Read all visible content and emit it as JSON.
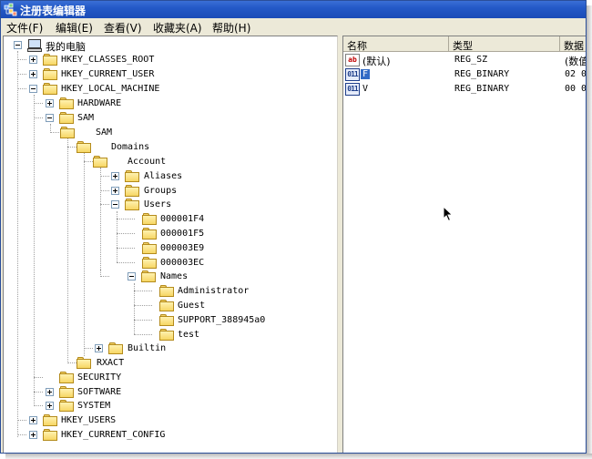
{
  "window": {
    "title": "注册表编辑器",
    "menu": [
      "文件(F)",
      "编辑(E)",
      "查看(V)",
      "收藏夹(A)",
      "帮助(H)"
    ]
  },
  "tree": {
    "root": "我的电脑",
    "nodes": [
      {
        "label": "HKEY_CLASSES_ROOT",
        "expander": "plus"
      },
      {
        "label": "HKEY_CURRENT_USER",
        "expander": "plus"
      },
      {
        "label": "HKEY_LOCAL_MACHINE",
        "expander": "minus"
      },
      {
        "label": "HARDWARE",
        "expander": "plus"
      },
      {
        "label": "SAM",
        "expander": "minus"
      },
      {
        "label": "SAM",
        "expander": "minus"
      },
      {
        "label": "Domains",
        "expander": "minus"
      },
      {
        "label": "Account",
        "expander": "minus"
      },
      {
        "label": "Aliases",
        "expander": "plus"
      },
      {
        "label": "Groups",
        "expander": "plus"
      },
      {
        "label": "Users",
        "expander": "minus"
      },
      {
        "label": "000001F4",
        "expander": "none"
      },
      {
        "label": "000001F5",
        "expander": "none"
      },
      {
        "label": "000003E9",
        "expander": "none"
      },
      {
        "label": "000003EC",
        "expander": "none"
      },
      {
        "label": "Names",
        "expander": "minus"
      },
      {
        "label": "Administrator",
        "expander": "none"
      },
      {
        "label": "Guest",
        "expander": "none"
      },
      {
        "label": "SUPPORT_388945a0",
        "expander": "none"
      },
      {
        "label": "test",
        "expander": "none"
      },
      {
        "label": "Builtin",
        "expander": "plus"
      },
      {
        "label": "RXACT",
        "expander": "none"
      },
      {
        "label": "SECURITY",
        "expander": "none"
      },
      {
        "label": "SOFTWARE",
        "expander": "plus"
      },
      {
        "label": "SYSTEM",
        "expander": "plus"
      },
      {
        "label": "HKEY_USERS",
        "expander": "plus"
      },
      {
        "label": "HKEY_CURRENT_CONFIG",
        "expander": "plus"
      }
    ]
  },
  "values_list": {
    "headers": {
      "name": "名称",
      "type": "类型",
      "data": "数据"
    },
    "rows": [
      {
        "icon": "string-value-icon",
        "icon_text": "ab",
        "name": "(默认)",
        "type": "REG_SZ",
        "data": "(数值"
      },
      {
        "icon": "binary-value-icon",
        "icon_text": "011",
        "name": "F",
        "type": "REG_BINARY",
        "data": "02 0",
        "selected": true
      },
      {
        "icon": "binary-value-icon",
        "icon_text": "011",
        "name": "V",
        "type": "REG_BINARY",
        "data": "00 0"
      }
    ]
  }
}
